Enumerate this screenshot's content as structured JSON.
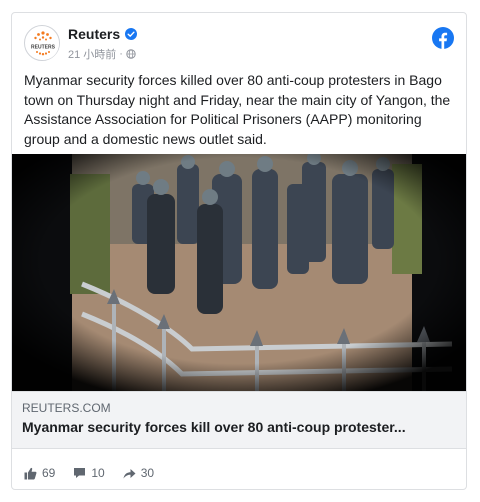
{
  "post": {
    "page_name": "Reuters",
    "avatar_text": "REUTERS",
    "timestamp": "21 小時前",
    "body": "Myanmar security forces killed over 80 anti-coup protesters in Bago town on Thursday night and Friday, near the main city of Yangon, the Assistance Association for Political Prisoners (AAPP) monitoring group and a domestic news outlet said."
  },
  "link": {
    "domain": "REUTERS.COM",
    "title": "Myanmar security forces kill over 80 anti-coup protester..."
  },
  "stats": {
    "likes": "69",
    "comments": "10",
    "shares": "30"
  },
  "icons": {
    "verified": "verified-badge-icon",
    "globe": "globe-icon",
    "facebook": "facebook-logo-icon",
    "like": "thumbs-up-icon",
    "comment": "comment-icon",
    "share": "share-arrow-icon"
  },
  "colors": {
    "facebook_blue": "#1877f2",
    "reuters_orange": "#f47b20"
  }
}
